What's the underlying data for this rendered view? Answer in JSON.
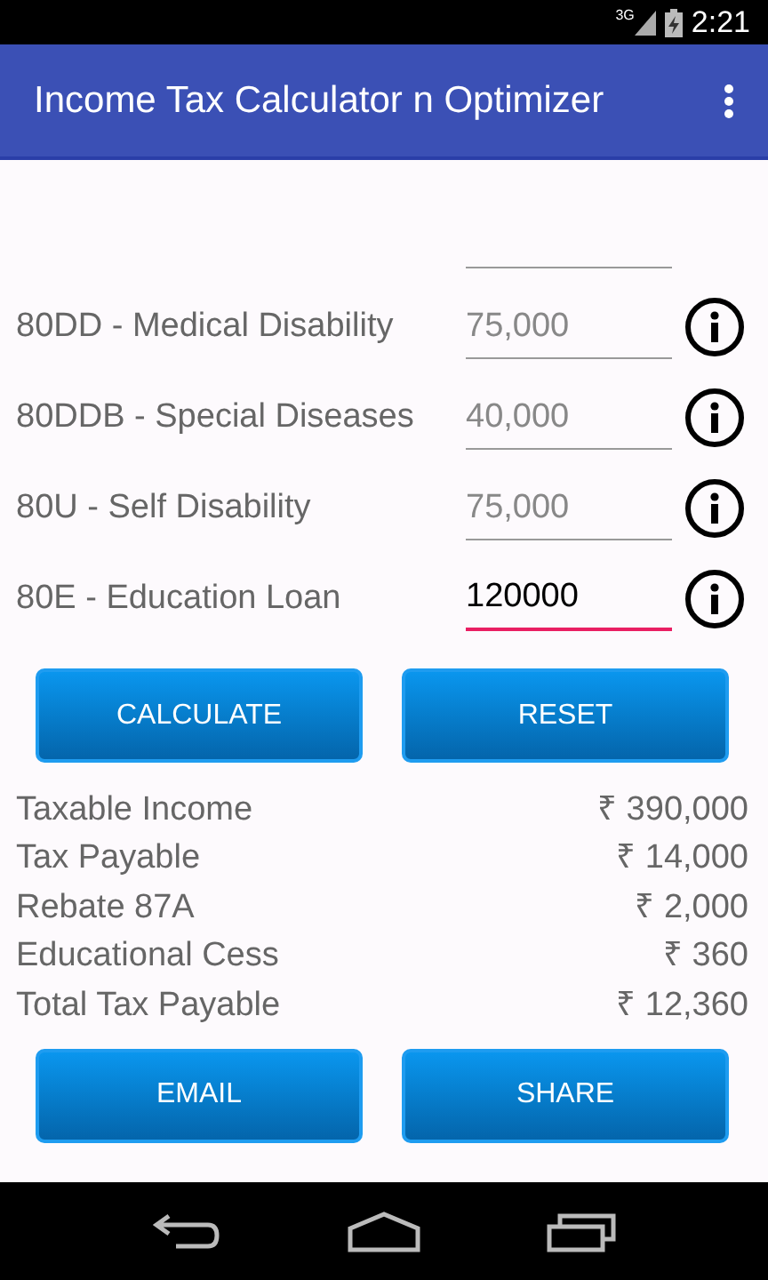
{
  "status_bar": {
    "network": "3G",
    "time": "2:21"
  },
  "app_bar": {
    "title": "Income Tax Calculator n Optimizer"
  },
  "deductions": [
    {
      "label": "80DD - Medical Disability",
      "placeholder": "75,000",
      "focused": false
    },
    {
      "label": "80DDB - Special Diseases",
      "placeholder": "40,000",
      "focused": false
    },
    {
      "label": "80U - Self Disability",
      "placeholder": "75,000",
      "focused": false
    },
    {
      "label": "80E - Education Loan",
      "value": "120000",
      "focused": true
    }
  ],
  "action_buttons": [
    "CALCULATE",
    "RESET"
  ],
  "results": [
    {
      "label": "Taxable Income",
      "value": "₹ 390,000"
    },
    {
      "label": "Tax Payable",
      "value": "₹ 14,000"
    },
    {
      "label": "Rebate 87A",
      "value": "₹ 2,000"
    },
    {
      "label": "Educational Cess",
      "value": "₹ 360"
    },
    {
      "label": "Total Tax Payable",
      "value": "₹ 12,360"
    }
  ],
  "share_buttons": [
    "EMAIL",
    "SHARE"
  ]
}
